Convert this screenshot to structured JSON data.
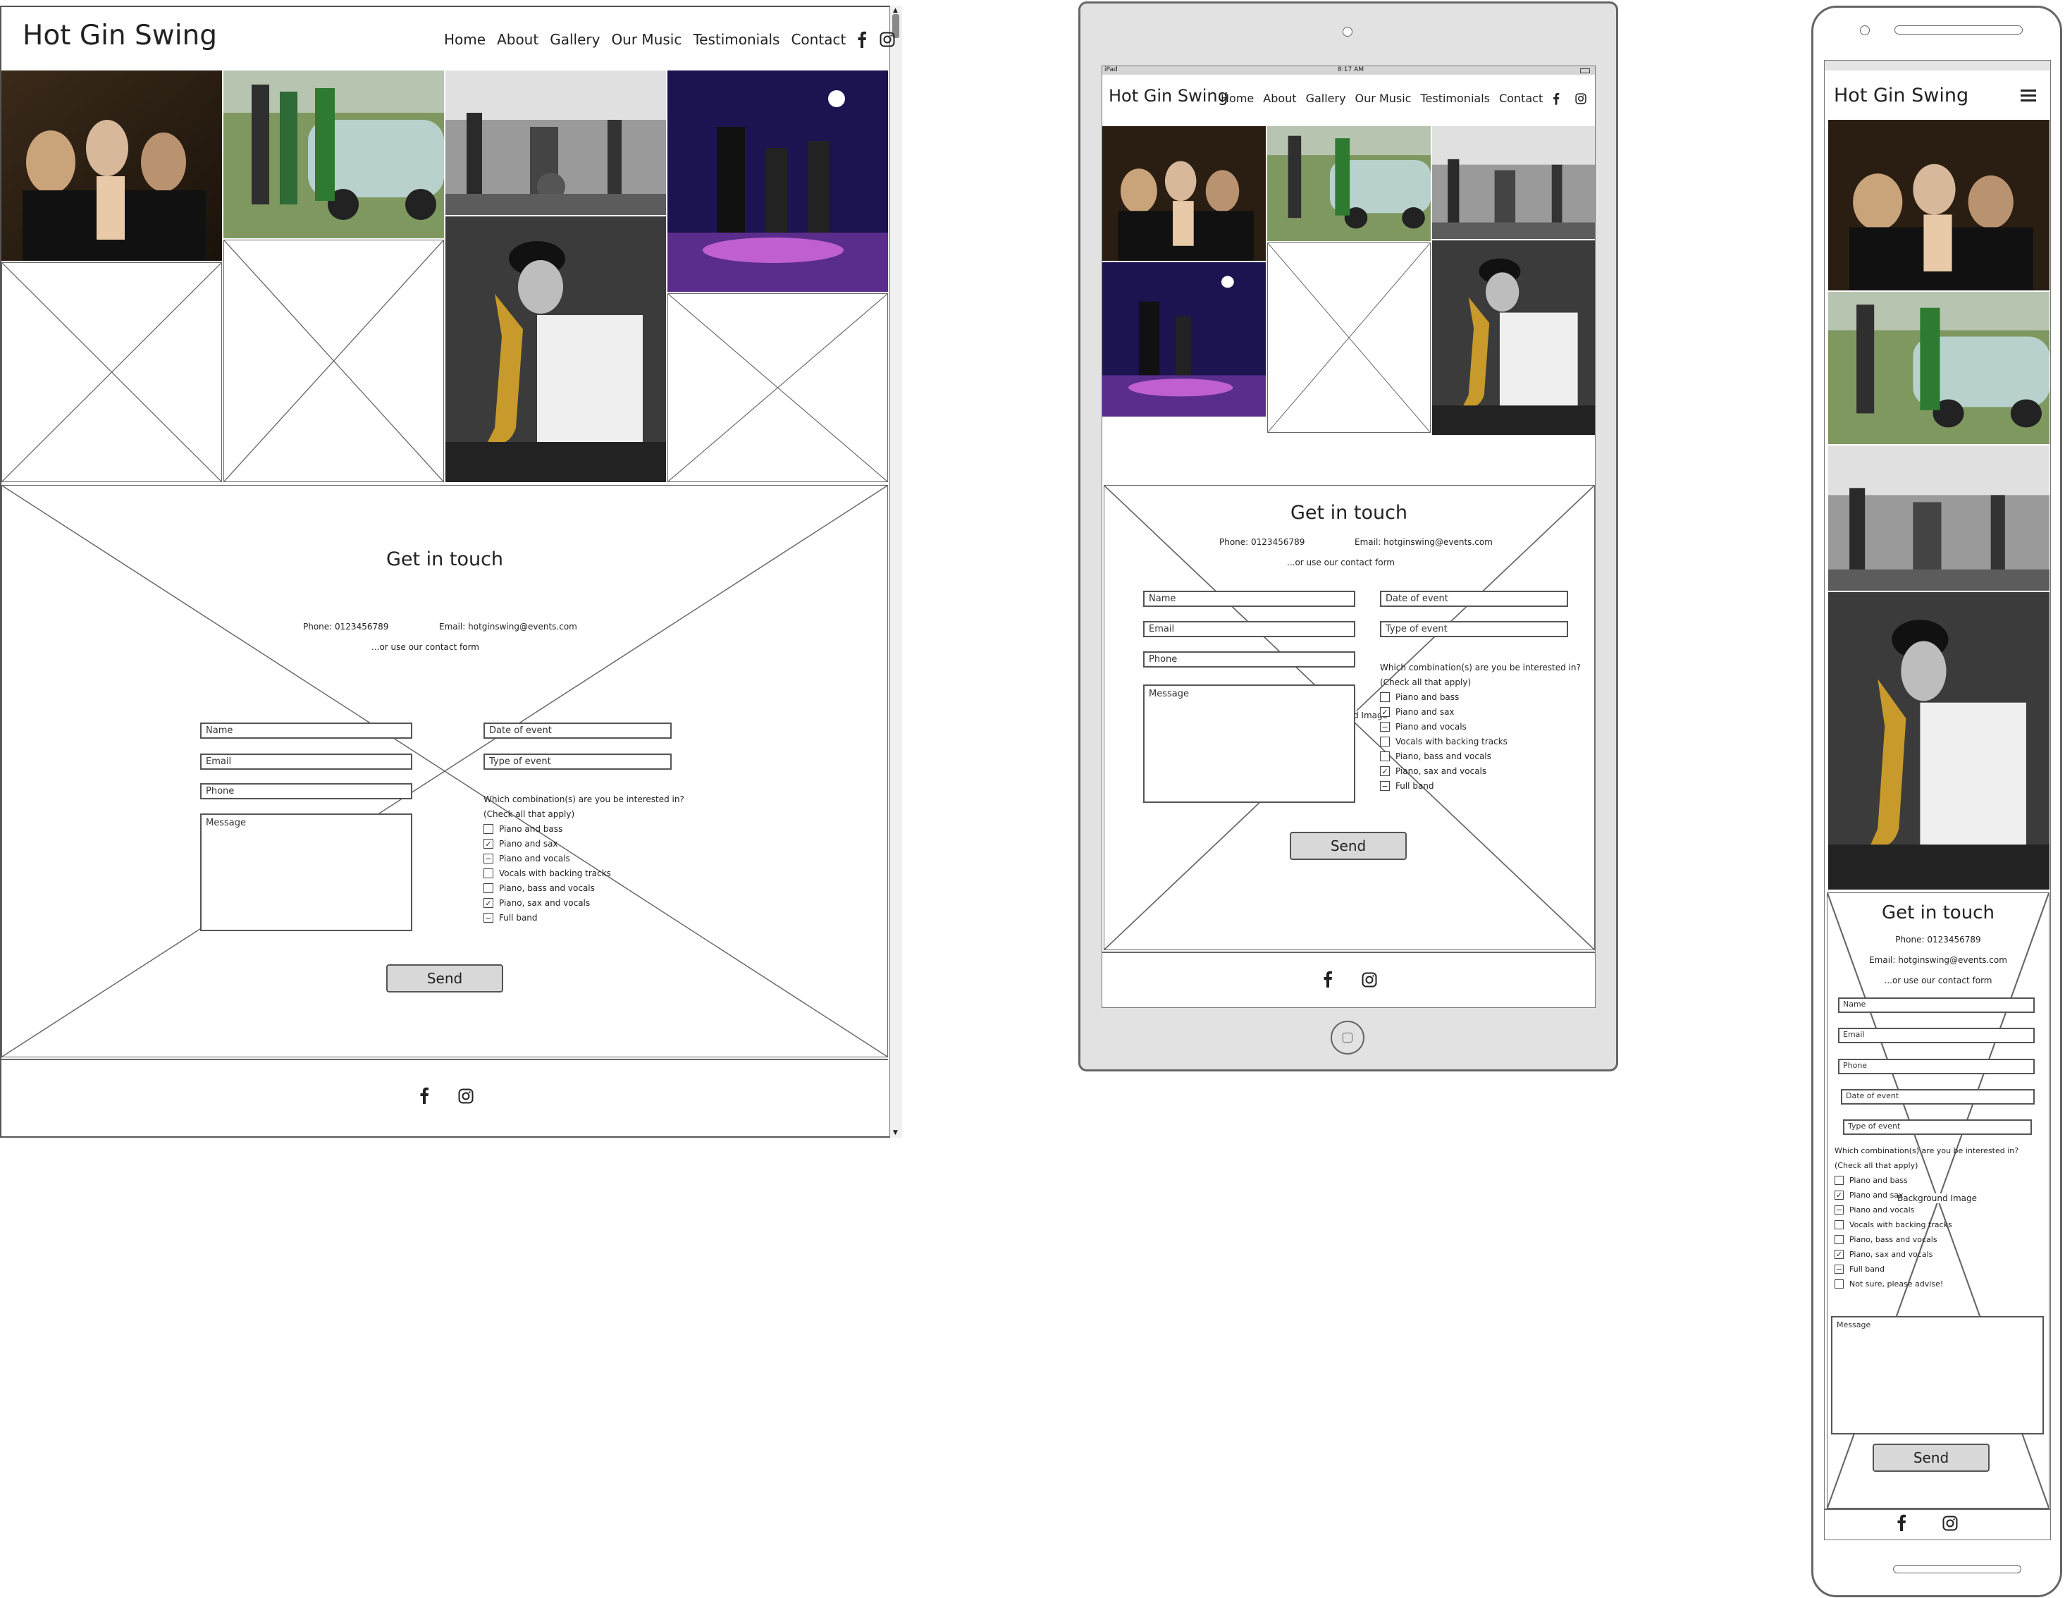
{
  "brand": "Hot Gin Swing",
  "nav": [
    "Home",
    "About",
    "Gallery",
    "Our Music",
    "Testimonials",
    "Contact"
  ],
  "status_bar": {
    "device": "iPad",
    "time": "8:17 AM"
  },
  "contact": {
    "heading": "Get in touch",
    "phone": "Phone: 0123456789",
    "email": "Email: hotginswing@events.com",
    "alt": "...or use our contact form",
    "fields": {
      "name": "Name",
      "email": "Email",
      "phone": "Phone",
      "date": "Date of event",
      "type": "Type of event",
      "message": "Message"
    },
    "question_line1": "Which combination(s) are you be interested in?",
    "question_line2": "(Check all that apply)",
    "options": [
      "Piano and bass",
      "Piano and sax",
      "Piano and vocals",
      "Vocals with backing tracks",
      "Piano, bass and vocals",
      "Piano, sax and vocals",
      "Full band"
    ],
    "extra_option_mobile": "Not sure, please advise!",
    "send": "Send",
    "bg_label_tablet": "d Image",
    "bg_label_mobile": "Background Image"
  },
  "icons": {
    "facebook": "facebook-icon",
    "instagram": "instagram-icon",
    "menu": "hamburger-menu-icon",
    "camera": "camera-icon",
    "home_button": "home-button-icon"
  }
}
